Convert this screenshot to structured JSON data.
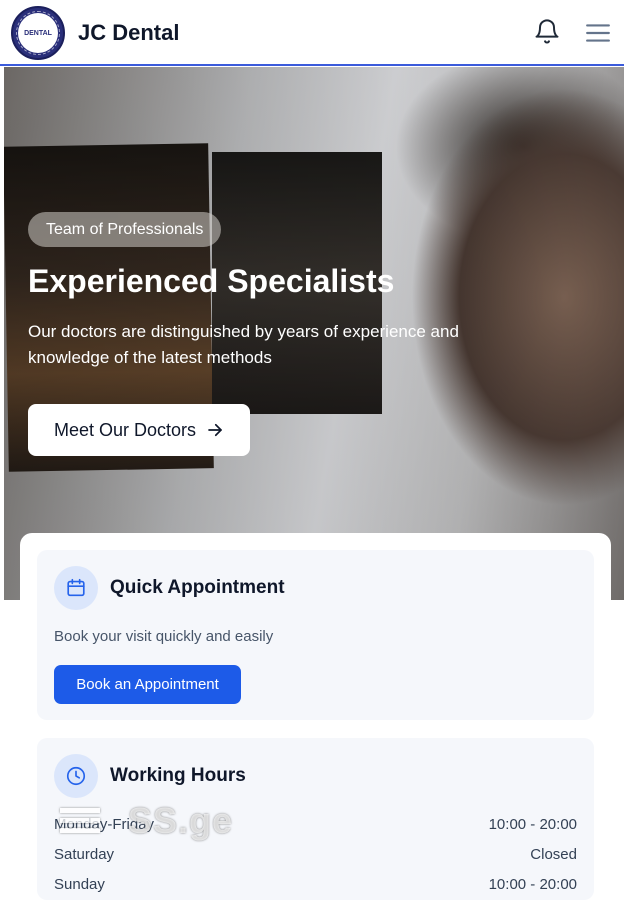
{
  "header": {
    "logo_text": "DENTAL",
    "brand": "JC Dental",
    "icons": [
      "bell-icon",
      "menu-icon"
    ]
  },
  "hero": {
    "badge": "Team of Professionals",
    "title": "Experienced Specialists",
    "subtitle": "Our doctors are distinguished by years of experience and knowledge of the latest methods",
    "cta_label": "Meet Our Doctors"
  },
  "appointment": {
    "title": "Quick Appointment",
    "text": "Book your visit quickly and easily",
    "button_label": "Book an Appointment",
    "icon": "calendar-icon"
  },
  "hours": {
    "title": "Working Hours",
    "icon": "clock-icon",
    "rows": [
      {
        "day": "Monday-Friday",
        "time": "10:00 - 20:00"
      },
      {
        "day": "Saturday",
        "time": "Closed"
      },
      {
        "day": "Sunday",
        "time": "10:00 - 20:00"
      }
    ]
  },
  "watermark": "SS.ge",
  "colors": {
    "accent": "#1d5be8",
    "header_border": "#3b5bdb",
    "card_bg": "#f5f7fb"
  }
}
